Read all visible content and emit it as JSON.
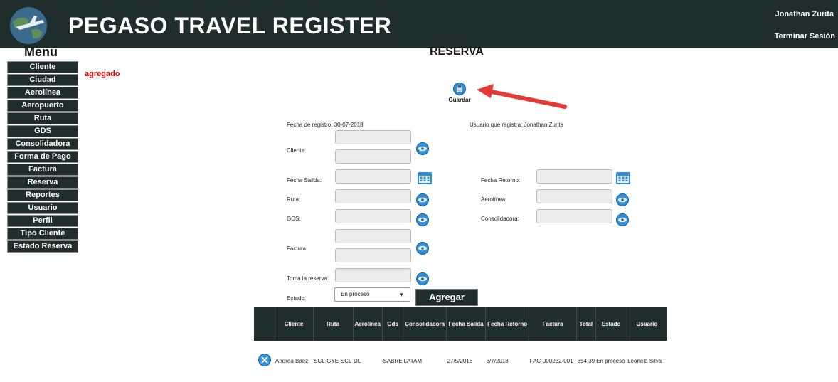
{
  "header": {
    "title": "PEGASO TRAVEL REGISTER",
    "user": "Jonathan Zurita",
    "logout_label": "Terminar Sesión",
    "logo_icon": "globe-airplane-icon",
    "bg_color": "#1f2d2d"
  },
  "menu": {
    "title": "Menú",
    "items": [
      "Cliente",
      "Ciudad",
      "Aerolínea",
      "Aeropuerto",
      "Ruta",
      "GDS",
      "Consolidadora",
      "Forma de Pago",
      "Factura",
      "Reserva",
      "Reportes",
      "Usuario",
      "Perfil",
      "Tipo Cliente",
      "Estado Reserva"
    ]
  },
  "message": "agregado",
  "page_title": "RESERVA",
  "save": {
    "label": "Guardar",
    "icon": "save-disk-icon"
  },
  "form": {
    "fecha_registro": "Fecha de registro: 30-07-2018",
    "usuario_registra": "Usuario que registra: Jonathan Zurita",
    "cliente_label": "Cliente:",
    "fecha_salida_label": "Fecha Salida:",
    "fecha_retorno_label": "Fecha Retorno:",
    "ruta_label": "Ruta:",
    "aerolinea_label": "Aerolínea:",
    "gds_label": "GDS:",
    "consolidadora_label": "Consolidadora:",
    "factura_label": "Factura:",
    "toma_label": "Toma la reserva:",
    "estado_label": "Estado:",
    "estado_value": "En proceso",
    "add_label": "Agregar"
  },
  "table": {
    "headers": [
      "Cliente",
      "Ruta",
      "Aerolinea",
      "Gds",
      "Consolidadora",
      "Fecha Salida",
      "Fecha Retorno",
      "Factura",
      "Total",
      "Estado",
      "Usuario"
    ],
    "rows": [
      [
        "Andrea Baez",
        "SCL-GYE-SCL",
        "DL",
        "SABRE",
        "LATAM",
        "27/5/2018",
        "3/7/2018",
        "FAC-000232-001",
        "354,39",
        "En proceso",
        "Leonela Silva"
      ]
    ]
  },
  "colors": {
    "accent_red": "#e00000",
    "arrow": "#e53935",
    "icon_blue": "#2f8fd8"
  }
}
